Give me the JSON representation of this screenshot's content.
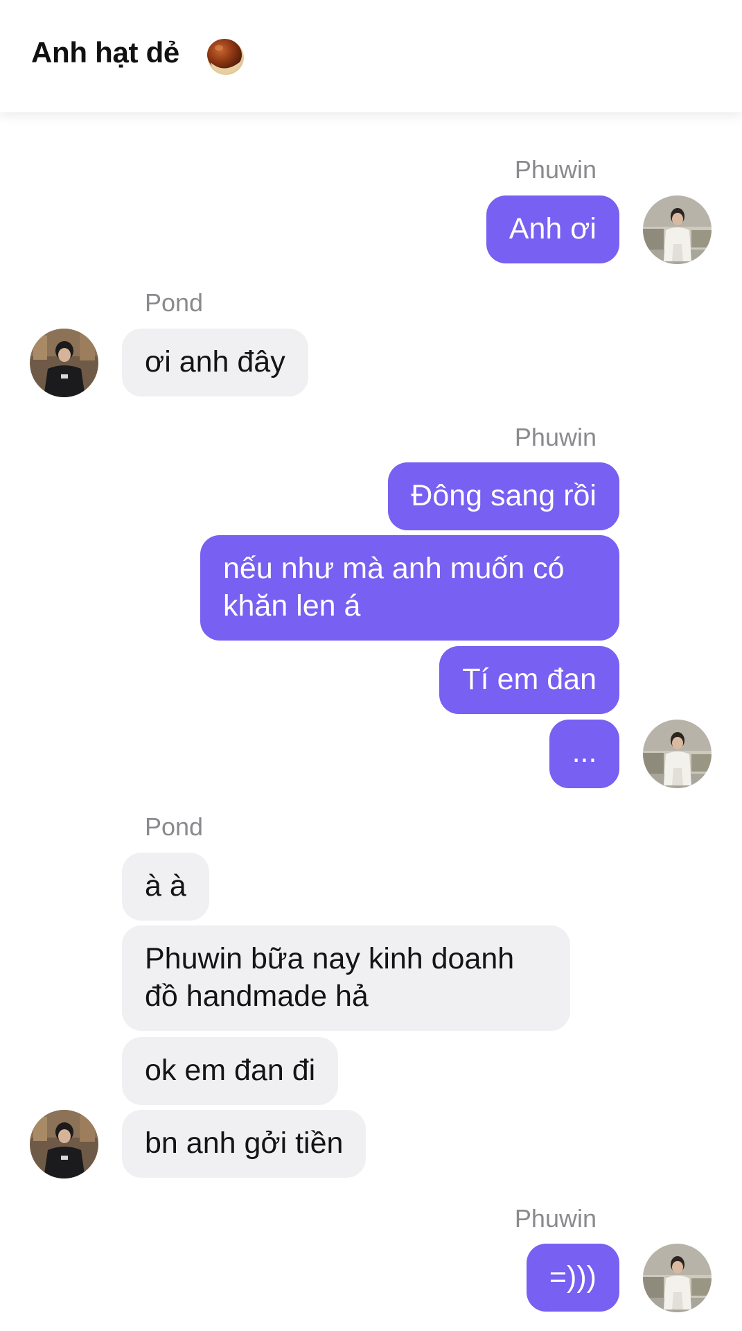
{
  "header": {
    "title": "Anh hạt dẻ",
    "title_icon": "chestnut-emoji"
  },
  "colors": {
    "outgoing_bubble": "#7760f2",
    "incoming_bubble": "#f0f0f2",
    "sender_name": "#8a8a8e"
  },
  "messages": {
    "group1": {
      "sender": "Phuwin",
      "m1": "Anh ơi"
    },
    "group2": {
      "sender": "Pond",
      "m1": "ơi anh đây"
    },
    "group3": {
      "sender": "Phuwin",
      "m1": "Đông sang rồi",
      "m2": "nếu như mà anh muốn có khăn len á",
      "m3": "Tí em đan",
      "m4": "..."
    },
    "group4": {
      "sender": "Pond",
      "m1": "à à",
      "m2": "Phuwin bữa nay kinh doanh đồ handmade hả",
      "m3": "ok em đan đi",
      "m4": "bn anh gởi tiền"
    },
    "group5": {
      "sender": "Phuwin",
      "m1": "=)))"
    }
  }
}
